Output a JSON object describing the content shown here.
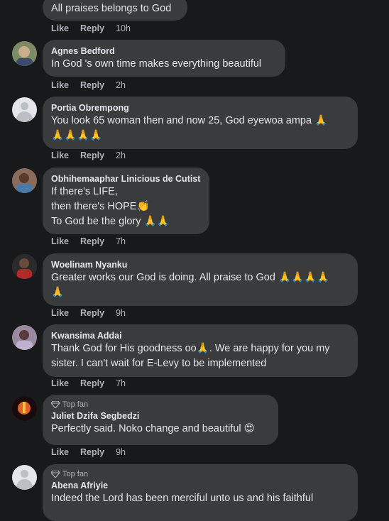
{
  "actions": {
    "like": "Like",
    "reply": "Reply"
  },
  "comments": [
    {
      "author": "",
      "lines": [
        "All praises belongs to God"
      ],
      "time": "10h"
    },
    {
      "author": "Agnes Bedford",
      "lines": [
        "In God 's own time makes everything beautiful"
      ],
      "time": "2h"
    },
    {
      "author": "Portia Obrempong",
      "lines": [
        "You look 65 woman then and now 25, God eyewoa ampa 🙏",
        "🙏🙏🙏🙏"
      ],
      "time": "2h"
    },
    {
      "author": "Obhihemaaphar Linicious de Cutist",
      "lines": [
        "If there's LIFE,",
        "then there's HOPE👏",
        "To God be the glory 🙏🙏"
      ],
      "time": "7h"
    },
    {
      "author": "Woelinam Nyanku",
      "lines": [
        "Greater works our God is doing. All praise to God 🙏🙏🙏🙏",
        "🙏"
      ],
      "time": "9h"
    },
    {
      "author": "Kwansima Addai",
      "lines": [
        "Thank God for His goodness oo🙏. We are happy for you my",
        "sister. I can't wait for E-Levy to be implemented"
      ],
      "time": "7h"
    },
    {
      "author": "Juliet Dzifa Segbedzi",
      "badge": "Top fan",
      "lines": [
        "Perfectly said. Noko change and beautiful 😍"
      ],
      "time": "9h"
    },
    {
      "author": "Abena Afriyie",
      "badge": "Top fan",
      "lines": [
        "Indeed the Lord has been merciful unto us and his faithful"
      ],
      "time": ""
    }
  ]
}
